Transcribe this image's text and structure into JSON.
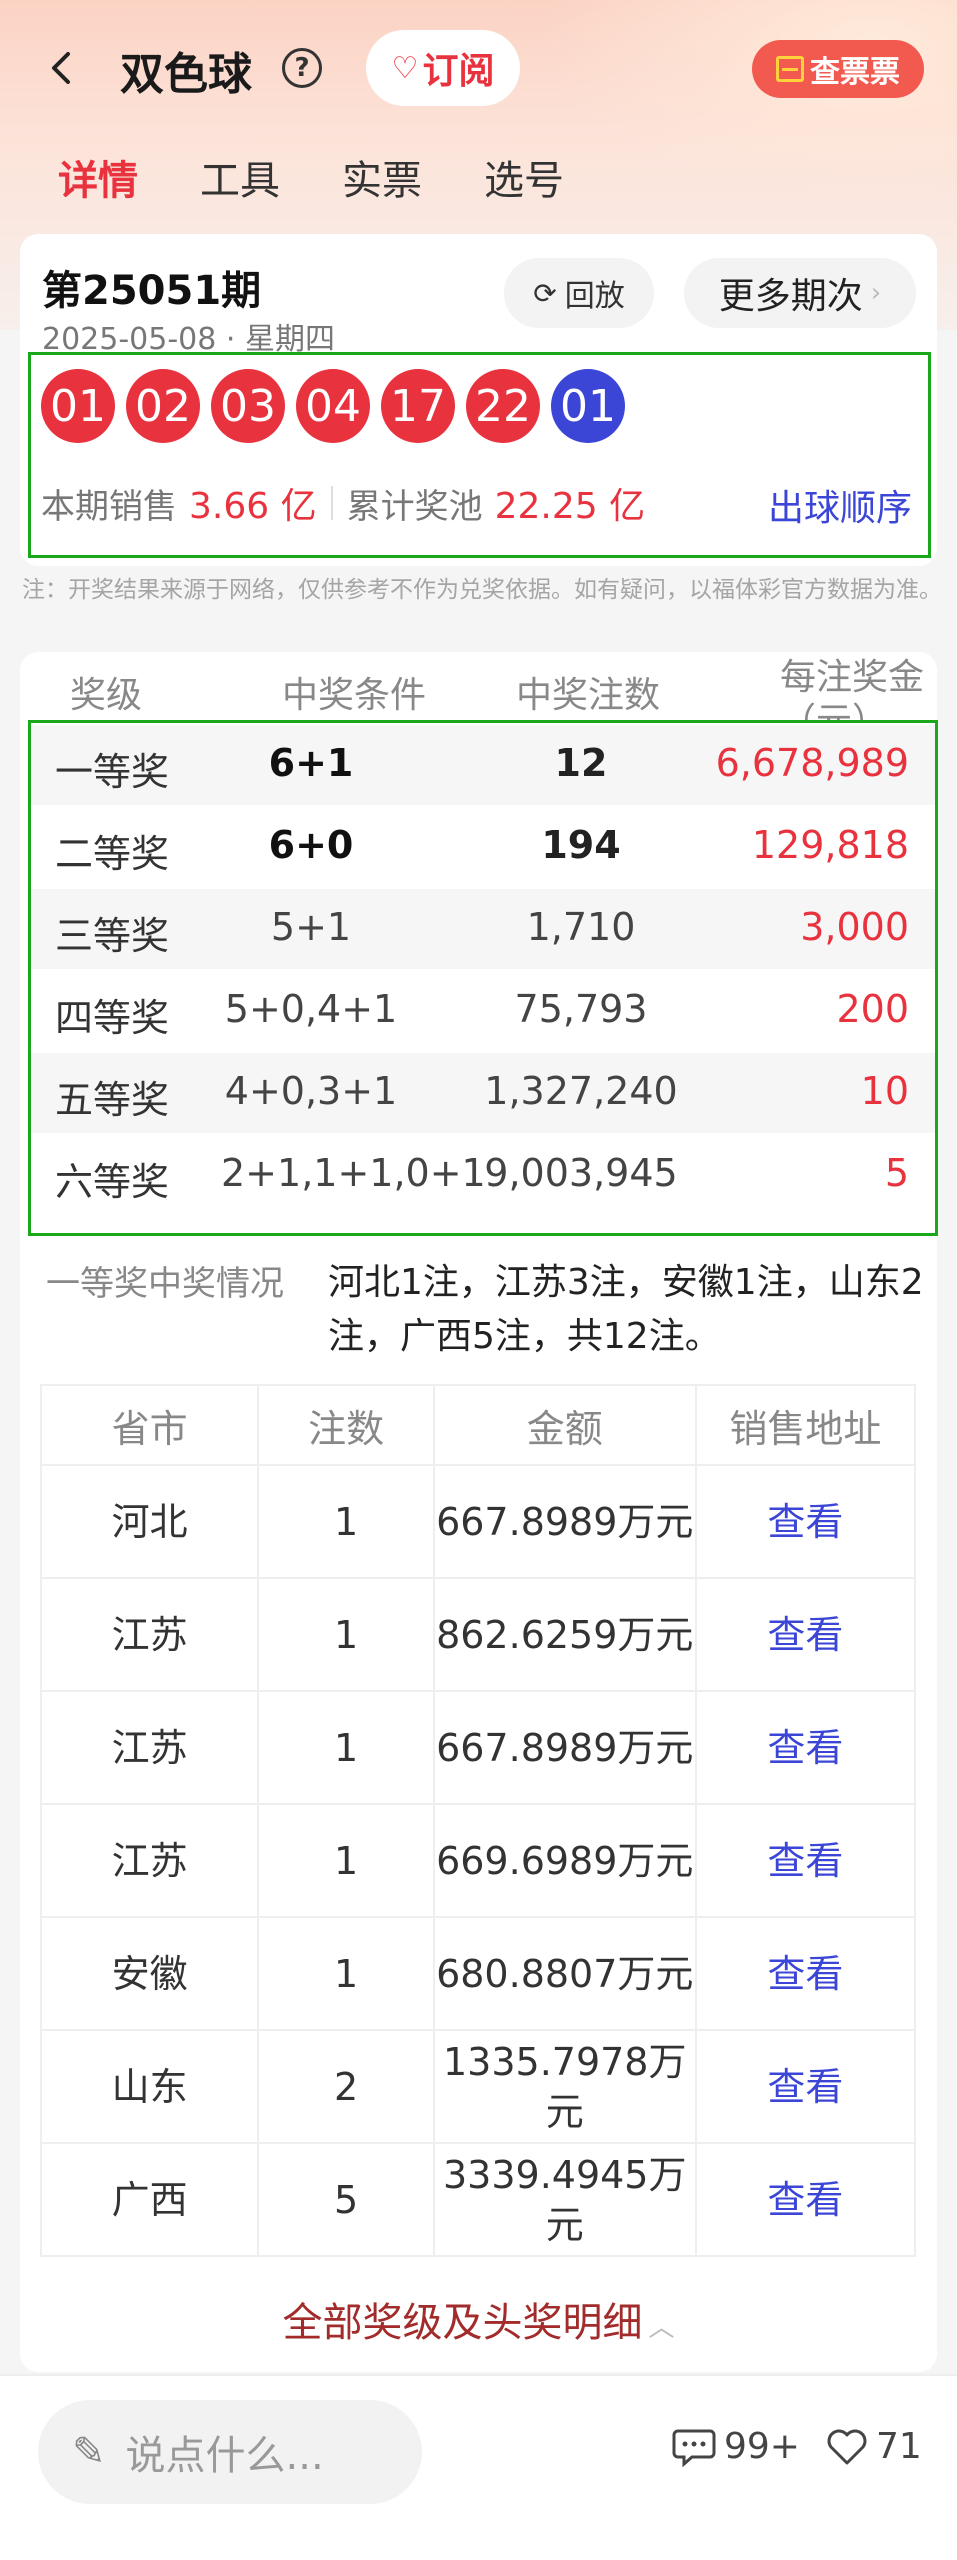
{
  "header": {
    "title": "双色球",
    "help_icon": "question-circle-icon",
    "subscribe_label": "订阅",
    "ticket_label": "查票票"
  },
  "tabs": [
    "详情",
    "工具",
    "实票",
    "选号"
  ],
  "draw": {
    "issue": "第25051期",
    "date": "2025-05-08",
    "weekday": "星期四",
    "replay_label": "回放",
    "more_label": "更多期次",
    "red_balls": [
      "01",
      "02",
      "03",
      "04",
      "17",
      "22"
    ],
    "blue_ball": "01",
    "sales_label": "本期销售",
    "sales_value": "3.66 亿",
    "pool_label": "累计奖池",
    "pool_value": "22.25 亿",
    "order_label": "出球顺序"
  },
  "disclaimer": "注：开奖结果来源于网络，仅供参考不作为兑奖依据。如有疑问，以福体彩官方数据为准。",
  "prize_table": {
    "headers": [
      "奖级",
      "中奖条件",
      "中奖注数",
      "每注奖金",
      "（元）"
    ],
    "rows": [
      {
        "level": "一等奖",
        "cond": "6+1",
        "count": "12",
        "prize": "6,678,989"
      },
      {
        "level": "二等奖",
        "cond": "6+0",
        "count": "194",
        "prize": "129,818"
      },
      {
        "level": "三等奖",
        "cond": "5+1",
        "count": "1,710",
        "prize": "3,000"
      },
      {
        "level": "四等奖",
        "cond": "5+0,4+1",
        "count": "75,793",
        "prize": "200"
      },
      {
        "level": "五等奖",
        "cond": "4+0,3+1",
        "count": "1,327,240",
        "prize": "10"
      },
      {
        "level": "六等奖",
        "cond": "2+1,1+1,0+1",
        "count": "9,003,945",
        "prize": "5"
      }
    ]
  },
  "first_prize": {
    "label": "一等奖中奖情况",
    "text": "河北1注，江苏3注，安徽1注，山东2注，广西5注，共12注。"
  },
  "distribution": {
    "headers": [
      "省市",
      "注数",
      "金额",
      "销售地址"
    ],
    "rows": [
      {
        "province": "河北",
        "count": "1",
        "amount": "667.8989万元",
        "link": "查看"
      },
      {
        "province": "江苏",
        "count": "1",
        "amount": "862.6259万元",
        "link": "查看"
      },
      {
        "province": "江苏",
        "count": "1",
        "amount": "667.8989万元",
        "link": "查看"
      },
      {
        "province": "江苏",
        "count": "1",
        "amount": "669.6989万元",
        "link": "查看"
      },
      {
        "province": "安徽",
        "count": "1",
        "amount": "680.8807万元",
        "link": "查看"
      },
      {
        "province": "山东",
        "count": "2",
        "amount": "1335.7978万元",
        "link": "查看"
      },
      {
        "province": "广西",
        "count": "5",
        "amount": "3339.4945万元",
        "link": "查看"
      }
    ]
  },
  "all_levels_label": "全部奖级及头奖明细",
  "bottom": {
    "comment_placeholder": "说点什么...",
    "comments": "99+",
    "likes": "71"
  },
  "colors": {
    "accent_red": "#e8323e",
    "ball_blue": "#3c46d6",
    "highlight_border": "#1aa71a"
  }
}
